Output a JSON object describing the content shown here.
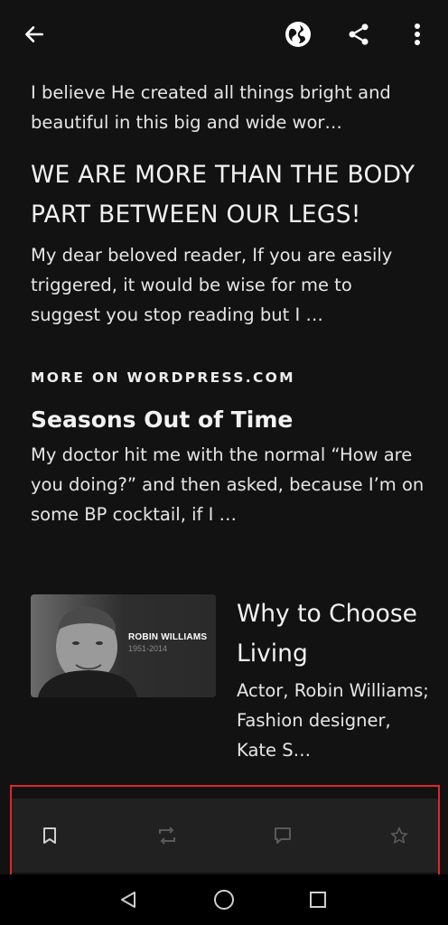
{
  "topbar": {
    "back_icon": "arrow-left-icon",
    "globe_icon": "globe-icon",
    "share_icon": "share-icon",
    "more_icon": "more-vertical-icon"
  },
  "post": {
    "excerpt_top": "I believe He created all things bright and beautiful in this big and wide wor…",
    "related_title": "WE ARE MORE THAN THE BODY PART BETWEEN OUR LEGS!",
    "related_excerpt": "My dear beloved reader, If you are easily triggered, it would be wise for me to suggest you stop reading but I …"
  },
  "more_section": {
    "label": "MORE ON WORDPRESS.COM",
    "card1_title": "Seasons Out of Time",
    "card1_excerpt": "My doctor hit me with the normal “How are you doing?” and then asked, because I’m on some BP cocktail, if I …",
    "card2_title": "Why to Choose Living",
    "card2_excerpt": "Actor, Robin Williams; Fashion designer, Kate S…",
    "thumb_caption_name": "ROBIN WILLIAMS",
    "thumb_caption_years": "1951-2014"
  },
  "actions": {
    "bookmark_icon": "bookmark-icon",
    "reblog_icon": "reblog-icon",
    "comment_icon": "comment-icon",
    "like_icon": "star-icon"
  },
  "nav": {
    "back": "triangle-back-icon",
    "home": "circle-home-icon",
    "recents": "square-recents-icon"
  },
  "colors": {
    "background": "#121212",
    "actionbar": "#212121",
    "highlight": "#e0262a"
  }
}
